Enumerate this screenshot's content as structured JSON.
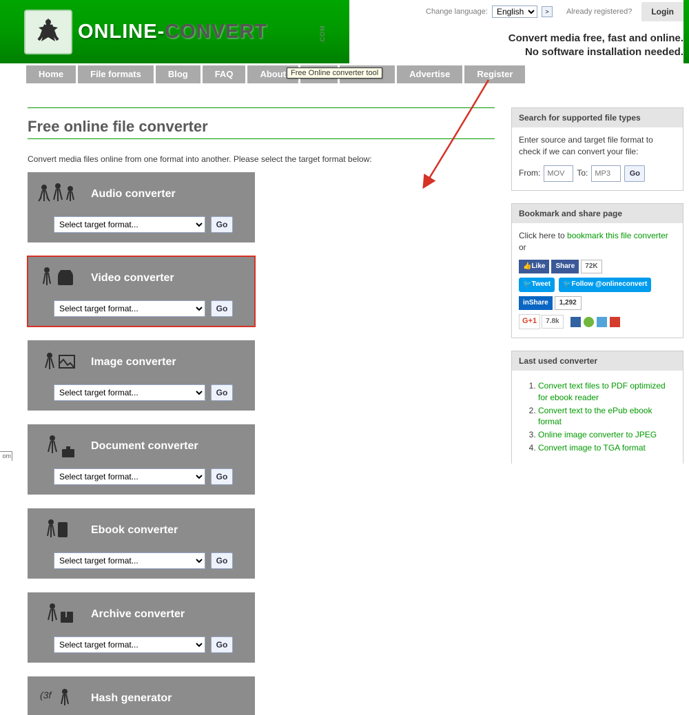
{
  "header": {
    "change_language": "Change language:",
    "lang_value": "English",
    "lang_go": ">",
    "already_registered": "Already registered?",
    "login": "Login",
    "tagline1": "Convert media free, fast and online.",
    "tagline2": "No software installation needed.",
    "logo_part1": "ONLINE",
    "logo_dash": "-",
    "logo_part2": "CONVERT",
    "logo_dotcom": ".COM"
  },
  "nav": {
    "items": [
      "Home",
      "File formats",
      "Blog",
      "FAQ",
      "About",
      "AP",
      "Donate",
      "Advertise",
      "Register"
    ]
  },
  "tooltip": "Free Online converter tool",
  "main": {
    "title": "Free online file converter",
    "intro": "Convert media files online from one format into another. Please select the target format below:",
    "cards": [
      {
        "title": "Audio converter",
        "placeholder": "Select target format...",
        "go": "Go",
        "highlighted": false
      },
      {
        "title": "Video converter",
        "placeholder": "Select target format...",
        "go": "Go",
        "highlighted": true
      },
      {
        "title": "Image converter",
        "placeholder": "Select target format...",
        "go": "Go",
        "highlighted": false
      },
      {
        "title": "Document converter",
        "placeholder": "Select target format...",
        "go": "Go",
        "highlighted": false
      },
      {
        "title": "Ebook converter",
        "placeholder": "Select target format...",
        "go": "Go",
        "highlighted": false
      },
      {
        "title": "Archive converter",
        "placeholder": "Select target format...",
        "go": "Go",
        "highlighted": false
      },
      {
        "title": "Hash generator",
        "placeholder": "Select target format...",
        "go": "Go",
        "highlighted": false
      }
    ]
  },
  "sidebar": {
    "search": {
      "title": "Search for supported file types",
      "desc": "Enter source and target file format to check if we can convert your file:",
      "from_label": "From:",
      "from_ph": "MOV",
      "to_label": "To:",
      "to_ph": "MP3",
      "go": "Go"
    },
    "bookmark": {
      "title": "Bookmark and share page",
      "text1": "Click here to ",
      "link": "bookmark this file converter",
      "text2": " or",
      "fb_like": "Like",
      "fb_share": "Share",
      "fb_count": "72K",
      "tweet": "Tweet",
      "follow": "Follow @onlineconvert",
      "li_share": "Share",
      "li_count": "1,292",
      "gp": "G+1",
      "gp_count": "7.8k"
    },
    "last": {
      "title": "Last used converter",
      "items": [
        "Convert text files to PDF optimized for ebook reader",
        "Convert text to the ePub ebook format",
        "Online image converter to JPEG",
        "Convert image to TGA format"
      ]
    }
  },
  "browser_stub": "om"
}
